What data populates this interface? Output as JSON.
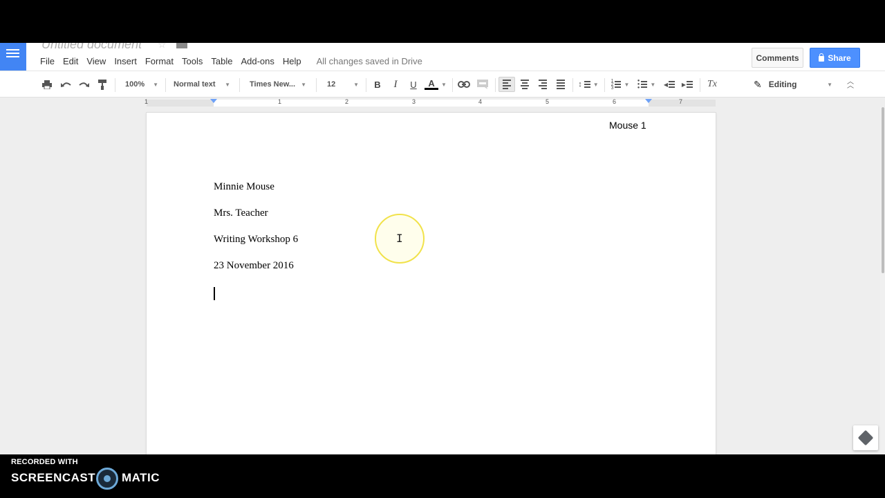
{
  "document": {
    "title": "Untitled document",
    "save_status": "All changes saved in Drive"
  },
  "menu": [
    "File",
    "Edit",
    "View",
    "Insert",
    "Format",
    "Tools",
    "Table",
    "Add-ons",
    "Help"
  ],
  "header_buttons": {
    "comments": "Comments",
    "share": "Share"
  },
  "toolbar": {
    "zoom": "100%",
    "style": "Normal text",
    "font": "Times New...",
    "font_size": "12",
    "bold": "B",
    "italic": "I",
    "underline": "U",
    "text_color": "A",
    "clear_formatting": "Tx",
    "mode": "Editing"
  },
  "ruler": {
    "numbers": [
      "1",
      "1",
      "2",
      "3",
      "4",
      "5",
      "6",
      "7"
    ]
  },
  "page": {
    "header_text": "Mouse 1",
    "paragraphs": [
      "Minnie Mouse",
      "Mrs. Teacher",
      "Writing Workshop 6",
      "23 November 2016"
    ]
  },
  "watermark": {
    "line1": "RECORDED WITH",
    "word1": "SCREENCAST",
    "word2": "MATIC"
  },
  "colors": {
    "share_blue": "#4d90fe",
    "docs_blue": "#4285f4",
    "cursor_highlight": "#f1e24a"
  }
}
